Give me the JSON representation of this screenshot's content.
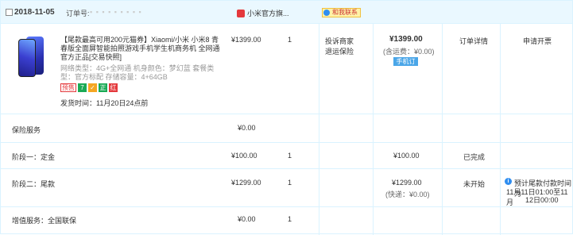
{
  "header": {
    "date": "2018-11-05",
    "order_no_label": "订单号:",
    "order_no_mask": "▪ ▪ ▪ ▪ ▪ ▪ ▪ ▪ ▪",
    "shop_name": "小米官方旗...",
    "contact_label": "和我联系"
  },
  "product": {
    "title": "【尾款最高可用200元猫券】Xiaomi/小米 小米8 青春版全面屏智能拍照游戏手机学生机商务机 全网通官方正品[交易快照]",
    "attrs": "网络类型：4G+全网通  机身颜色：梦幻蓝  套餐类型：官方标配  存储容量：4+64GB",
    "tags": [
      "预售",
      "7",
      "✓",
      "正",
      "红"
    ],
    "ship_time": "发货时间：11月20日24点前",
    "unit_price": "¥1399.00",
    "qty": "1",
    "service_1": "投诉商家",
    "service_2": "退运保险",
    "total": "¥1399.00",
    "shipping": "(含运费：¥0.00)",
    "pay_button": "手机订单",
    "details_link": "订单详情",
    "invoice_link": "申请开票"
  },
  "insurance": {
    "label": "保险服务",
    "price": "¥0.00"
  },
  "stage1": {
    "label": "阶段一：定金",
    "price": "¥100.00",
    "qty": "1",
    "total": "¥100.00",
    "status": "已完成"
  },
  "stage2": {
    "label": "阶段二：尾款",
    "price": "¥1299.00",
    "qty": "1",
    "total": "¥1299.00",
    "shipping": "(快递：¥0.00)",
    "status": "未开始",
    "note_1": "预计尾款付款时间为",
    "note_2": "11月11日01:00至11月",
    "note_3": "12日00:00"
  },
  "value_added": {
    "label": "增值服务：全国联保",
    "price": "¥0.00",
    "qty": "1"
  },
  "colors": {
    "header_bg": "#eaf8ff",
    "border": "#daf3ff",
    "accent_blue": "#4aa6e8",
    "brand_red": "#e4393c"
  }
}
